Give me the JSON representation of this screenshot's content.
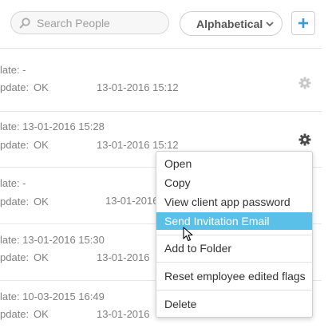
{
  "toolbar": {
    "search_placeholder": "Search People",
    "sort_label": "Alphabetical",
    "add_label": "+"
  },
  "rows": [
    {
      "line1": "late: -",
      "line2_label": "pdate:",
      "line2_status": "OK",
      "line2_date": "13-01-2016 15:12"
    },
    {
      "line1": "late: 13-01-2016 15:28",
      "line2_label": "pdate:",
      "line2_status": "OK",
      "line2_date": "13-01-2016 15:12"
    },
    {
      "line1": "late: -",
      "line2_label": "pdate:",
      "line2_status": "OK",
      "line2_date": "13-01-2016"
    },
    {
      "line1": "late: 13-01-2016 15:30",
      "line2_label": "pdate:",
      "line2_status": "OK",
      "line2_date": "13-01-2016"
    },
    {
      "line1": "late: 10-03-2015 16:49",
      "line2_label": "pdate:",
      "line2_status": "OK",
      "line2_date": "13-01-2016"
    }
  ],
  "context_menu": {
    "items": [
      "Open",
      "Copy",
      "View client app password",
      "Send Invitation Email",
      "Add to Folder",
      "Reset employee edited flags",
      "Delete"
    ],
    "highlighted": "Send Invitation Email"
  },
  "colors": {
    "highlight": "#5bc0e8",
    "accent_blue": "#3a9ad9"
  },
  "icons": [
    "search-icon",
    "chevron-down-icon",
    "plus-icon",
    "gear-icon",
    "mouse-cursor-icon"
  ]
}
